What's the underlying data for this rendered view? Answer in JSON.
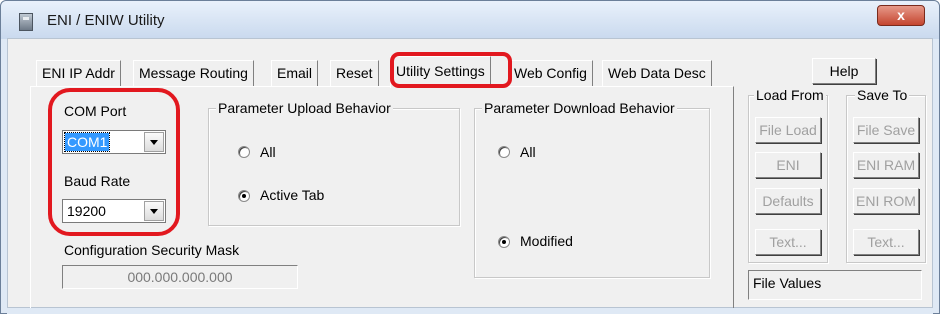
{
  "window": {
    "title": "ENI / ENIW Utility",
    "close_glyph": "x"
  },
  "tabs": [
    {
      "label": "ENI IP Addr",
      "active": false
    },
    {
      "label": "Message Routing",
      "active": false
    },
    {
      "label": "Email",
      "active": false
    },
    {
      "label": "Reset",
      "active": false
    },
    {
      "label": "Utility Settings",
      "active": true
    },
    {
      "label": "Web Config",
      "active": false
    },
    {
      "label": "Web Data Desc",
      "active": false
    }
  ],
  "utility_settings": {
    "com_port": {
      "label": "COM Port",
      "value": "COM1"
    },
    "baud_rate": {
      "label": "Baud Rate",
      "value": "19200"
    },
    "upload_group": {
      "title": "Parameter Upload Behavior",
      "options": [
        {
          "label": "All",
          "checked": false
        },
        {
          "label": "Active Tab",
          "checked": true
        }
      ]
    },
    "download_group": {
      "title": "Parameter Download Behavior",
      "options": [
        {
          "label": "All",
          "checked": false
        },
        {
          "label": "Modified",
          "checked": true
        }
      ]
    },
    "security_mask": {
      "label": "Configuration Security Mask",
      "value": "000.000.000.000"
    }
  },
  "side_panel": {
    "help_label": "Help",
    "load_from": {
      "title": "Load From",
      "buttons": [
        "File Load",
        "ENI",
        "Defaults",
        "Text..."
      ]
    },
    "save_to": {
      "title": "Save To",
      "buttons": [
        "File Save",
        "ENI RAM",
        "ENI ROM",
        "Text..."
      ]
    },
    "status_text": "File Values"
  },
  "colors": {
    "highlight": "#e2181f",
    "selection": "#3399ff",
    "window_frame": "#dfe9f5",
    "dialog_face": "#f0f0f0"
  },
  "icons": [
    "app-icon",
    "close-icon",
    "chevron-down-icon"
  ]
}
